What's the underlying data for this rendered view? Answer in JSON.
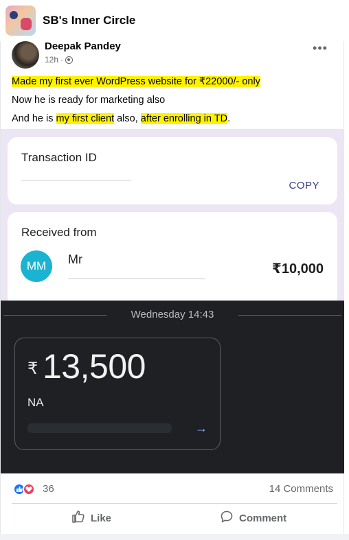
{
  "group": {
    "title": "SB's Inner Circle"
  },
  "post": {
    "author": "Deepak Pandey",
    "time": "12h",
    "lines": {
      "line1": "Made my first ever WordPress website for ₹22000/- only",
      "line2": "Now he is ready for marketing also",
      "line3_a": "And he is ",
      "line3_b": "my first client",
      "line3_c": " also, ",
      "line3_d": "after enrolling in TD",
      "line3_e": "."
    }
  },
  "screenshot": {
    "transaction_label": "Transaction ID",
    "copy_label": "COPY",
    "received_label": "Received from",
    "avatar_initials": "MM",
    "sender_name": "Mr",
    "received_amount": "₹10,000",
    "date_time": "Wednesday 14:43",
    "rupee_symbol": "₹",
    "payment_amount": "13,500",
    "payment_note": "NA",
    "arrow": "→"
  },
  "reactions": {
    "count": "36",
    "comments": "14 Comments"
  },
  "actions": {
    "like": "Like",
    "comment": "Comment"
  },
  "colors": {
    "highlight": "#fff200",
    "like_blue": "#1877f2",
    "love_red": "#f33e58",
    "accent_teal": "#1ab3d1"
  },
  "icons": [
    "group-avatar",
    "globe-icon",
    "more-options-icon",
    "like-reaction-icon",
    "love-reaction-icon",
    "like-thumb-icon",
    "comment-bubble-icon",
    "arrow-right-icon"
  ]
}
